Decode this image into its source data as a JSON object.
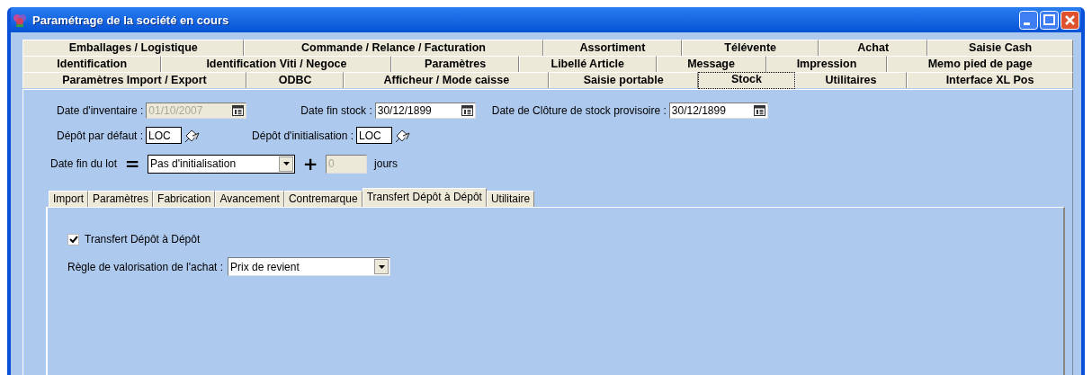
{
  "window": {
    "title": "Paramétrage de la société en cours"
  },
  "main_tabs": [
    [
      {
        "label": "Emballages / Logistique",
        "selected": false
      },
      {
        "label": "Commande / Relance / Facturation",
        "selected": false
      },
      {
        "label": "Assortiment",
        "selected": false
      },
      {
        "label": "Télévente",
        "selected": false
      },
      {
        "label": "Achat",
        "selected": false
      },
      {
        "label": "Saisie Cash",
        "selected": false
      }
    ],
    [
      {
        "label": "Identification",
        "selected": false
      },
      {
        "label": "Identification Viti / Negoce",
        "selected": false
      },
      {
        "label": "Paramètres",
        "selected": false
      },
      {
        "label": "Libellé Article",
        "selected": false
      },
      {
        "label": "Message",
        "selected": false
      },
      {
        "label": "Impression",
        "selected": false
      },
      {
        "label": "Memo pied de page",
        "selected": false
      }
    ],
    [
      {
        "label": "Paramètres Import / Export",
        "selected": false
      },
      {
        "label": "ODBC",
        "selected": false
      },
      {
        "label": "Afficheur / Mode caisse",
        "selected": false
      },
      {
        "label": "Saisie portable",
        "selected": false
      },
      {
        "label": "Stock",
        "selected": true
      },
      {
        "label": "Utilitaires",
        "selected": false
      },
      {
        "label": "Interface XL Pos",
        "selected": false
      }
    ]
  ],
  "dates": [
    {
      "label": "Date d'inventaire :",
      "value": "01/10/2007",
      "disabled": true
    },
    {
      "label": "Date fin stock :",
      "value": "30/12/1899",
      "disabled": false
    },
    {
      "label": "Date de Clôture de stock provisoire :",
      "value": "30/12/1899",
      "disabled": false
    }
  ],
  "depots": [
    {
      "label": "Dépôt par défaut :",
      "value": "LOC"
    },
    {
      "label": "Dépôt d'initialisation :",
      "value": "LOC"
    }
  ],
  "lot": {
    "label": "Date fin du lot",
    "equals": "=",
    "select": "Pas d'initialisation",
    "plus": "+",
    "days": "0",
    "days_disabled": true,
    "unit": "jours"
  },
  "sub_tabs": [
    {
      "label": "Import",
      "selected": false
    },
    {
      "label": "Paramètres",
      "selected": false
    },
    {
      "label": "Fabrication",
      "selected": false
    },
    {
      "label": "Avancement",
      "selected": false
    },
    {
      "label": "Contremarque",
      "selected": false
    },
    {
      "label": "Transfert Dépôt à Dépôt",
      "selected": true
    },
    {
      "label": "Utilitaire",
      "selected": false
    }
  ],
  "transfer": {
    "checkbox": {
      "label": "Transfert Dépôt à Dépôt",
      "checked": true
    },
    "rule": {
      "label": "Règle de valorisation de l'achat :",
      "value": "Prix de revient"
    }
  }
}
